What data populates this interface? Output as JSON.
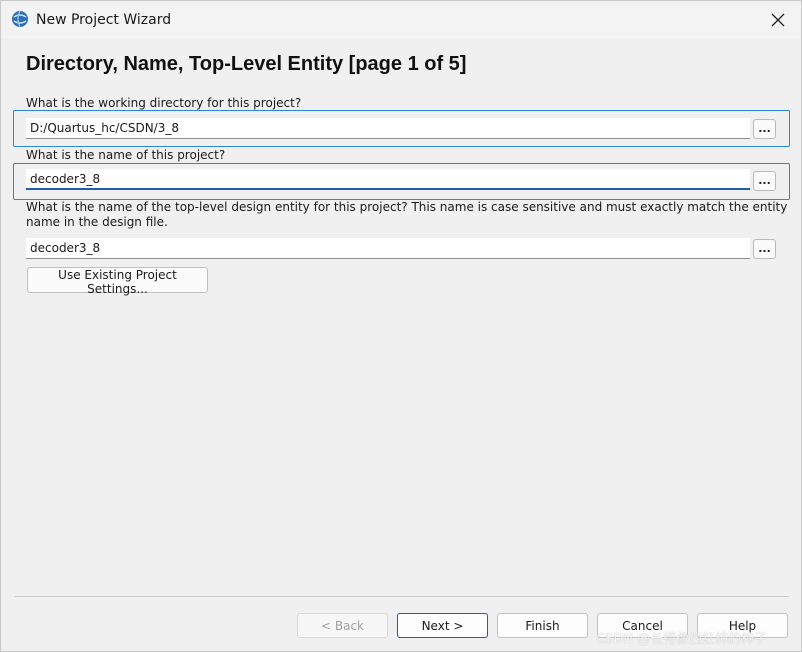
{
  "window": {
    "title": "New Project Wizard"
  },
  "page": {
    "heading": "Directory, Name, Top-Level Entity [page 1 of 5]"
  },
  "directory": {
    "label": "What is the working directory for this project?",
    "value": "D:/Quartus_hc/CSDN/3_8",
    "browse_label": "..."
  },
  "project_name": {
    "label": "What is the name of this project?",
    "value": "decoder3_8",
    "browse_label": "..."
  },
  "top_level": {
    "label_line1": "What is the name of the top-level design entity for this project? This name is case sensitive and must exactly match the entity",
    "label_line2": "name in the design file.",
    "value": "decoder3_8",
    "browse_label": "..."
  },
  "existing_settings_label": "Use Existing Project Settings...",
  "footer": {
    "back_label": "< Back",
    "next_label": "Next >",
    "finish_label": "Finish",
    "cancel_label": "Cancel",
    "help_label": "Help"
  },
  "watermark": "CSDN @长得像西红柿的柿子",
  "colors": {
    "focus_border": "#2e86d8",
    "default_button_border": "#1f5fa8",
    "background": "#f0f0f0"
  }
}
